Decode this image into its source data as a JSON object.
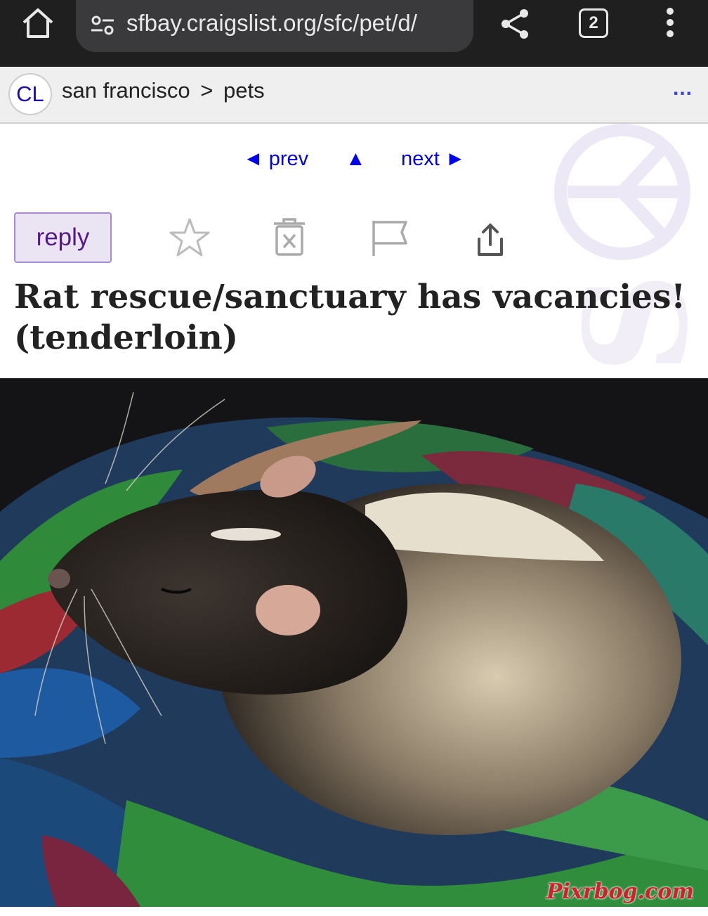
{
  "browser": {
    "url": "sfbay.craigslist.org/sfc/pet/d/",
    "tab_count": "2"
  },
  "header": {
    "logo": "CL",
    "breadcrumb_city": "san francisco",
    "breadcrumb_sep": ">",
    "breadcrumb_category": "pets",
    "more": "..."
  },
  "nav": {
    "prev": "◄ prev",
    "up": "▲",
    "next": "next ►"
  },
  "actions": {
    "reply": "reply"
  },
  "post": {
    "title": "Rat rescue/sanctuary has vacancies! (tenderloin)",
    "photo_watermark": "Pixrbog.com"
  },
  "colors": {
    "link": "#0000ee",
    "reply_text": "#551a8b",
    "reply_bg": "#ebe4f3"
  }
}
